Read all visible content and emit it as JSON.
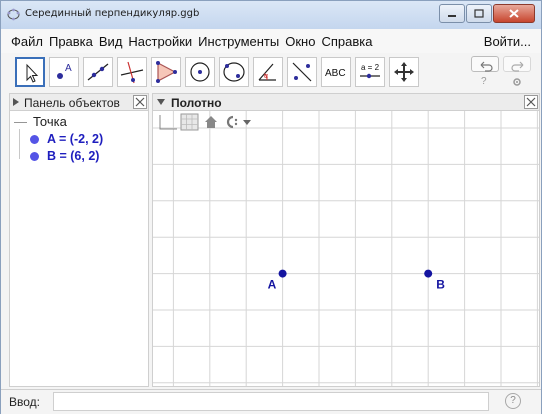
{
  "window": {
    "title": "Серединный перпендикуляр.ggb"
  },
  "menubar": {
    "items": [
      "Файл",
      "Правка",
      "Вид",
      "Настройки",
      "Инструменты",
      "Окно",
      "Справка"
    ],
    "signin_label": "Войти..."
  },
  "toolbar": {
    "tools": [
      {
        "icon": "move-tool-icon"
      },
      {
        "icon": "point-tool-icon"
      },
      {
        "icon": "line-tool-icon"
      },
      {
        "icon": "perpendicular-line-tool-icon"
      },
      {
        "icon": "polygon-tool-icon"
      },
      {
        "icon": "circle-center-point-tool-icon"
      },
      {
        "icon": "conic-five-points-tool-icon"
      },
      {
        "icon": "angle-tool-icon"
      },
      {
        "icon": "reflect-tool-icon"
      },
      {
        "icon": "text-tool-icon",
        "label": "ABC"
      },
      {
        "icon": "slider-tool-icon",
        "label": "a = 2"
      },
      {
        "icon": "move-graphics-view-tool-icon"
      }
    ],
    "undo_icon": "undo-icon",
    "redo_icon": "redo-icon",
    "help_symbol": "?"
  },
  "algebra": {
    "header_label": "Панель объектов",
    "folder_label": "Точка",
    "objects": [
      {
        "label": "A = (-2, 2)",
        "color": "#5454e6"
      },
      {
        "label": "B = (6, 2)",
        "color": "#5454e6"
      }
    ]
  },
  "graphics": {
    "header_label": "Полотно",
    "grid": true,
    "points": [
      {
        "name": "A",
        "x": -2,
        "y": 2,
        "color": "#1414a0"
      },
      {
        "name": "B",
        "x": 6,
        "y": 2,
        "color": "#1414a0"
      }
    ]
  },
  "inputbar": {
    "label": "Ввод:",
    "value": "",
    "help_symbol": "?"
  }
}
